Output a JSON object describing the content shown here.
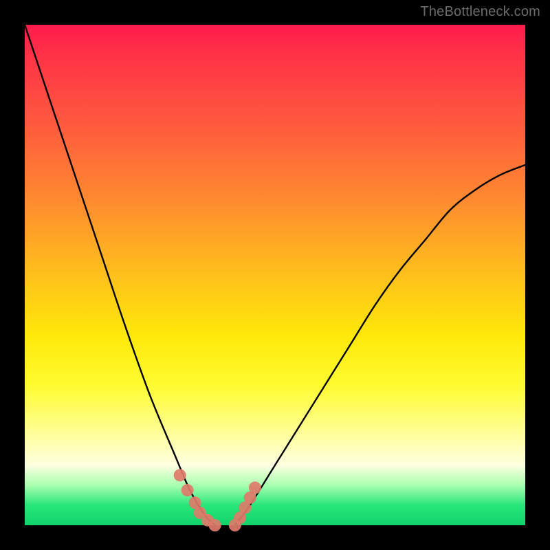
{
  "watermark": "TheBottleneck.com",
  "chart_data": {
    "type": "line",
    "title": "",
    "xlabel": "",
    "ylabel": "",
    "xlim": [
      0,
      100
    ],
    "ylim": [
      0,
      100
    ],
    "series": [
      {
        "name": "left-curve",
        "x": [
          0,
          5,
          10,
          15,
          20,
          25,
          30,
          33,
          36,
          38
        ],
        "values": [
          100,
          85,
          70,
          55,
          40,
          26,
          14,
          7,
          2,
          0
        ]
      },
      {
        "name": "right-curve",
        "x": [
          42,
          45,
          50,
          55,
          60,
          65,
          70,
          75,
          80,
          85,
          90,
          95,
          100
        ],
        "values": [
          0,
          4,
          12,
          20,
          28,
          36,
          44,
          51,
          57,
          63,
          67,
          70,
          72
        ]
      }
    ],
    "markers": {
      "name": "highlight-dots",
      "color": "#e07a6a",
      "x": [
        31.0,
        32.5,
        34.0,
        35.0,
        36.5,
        38.0,
        42.0,
        43.0,
        44.0,
        45.0,
        46.0
      ],
      "values": [
        10.0,
        7.0,
        4.5,
        2.5,
        1.0,
        0.0,
        0.0,
        1.5,
        3.5,
        5.5,
        7.5
      ]
    },
    "floor_band": {
      "name": "green-floor",
      "y_from": 0,
      "y_to": 6
    }
  }
}
